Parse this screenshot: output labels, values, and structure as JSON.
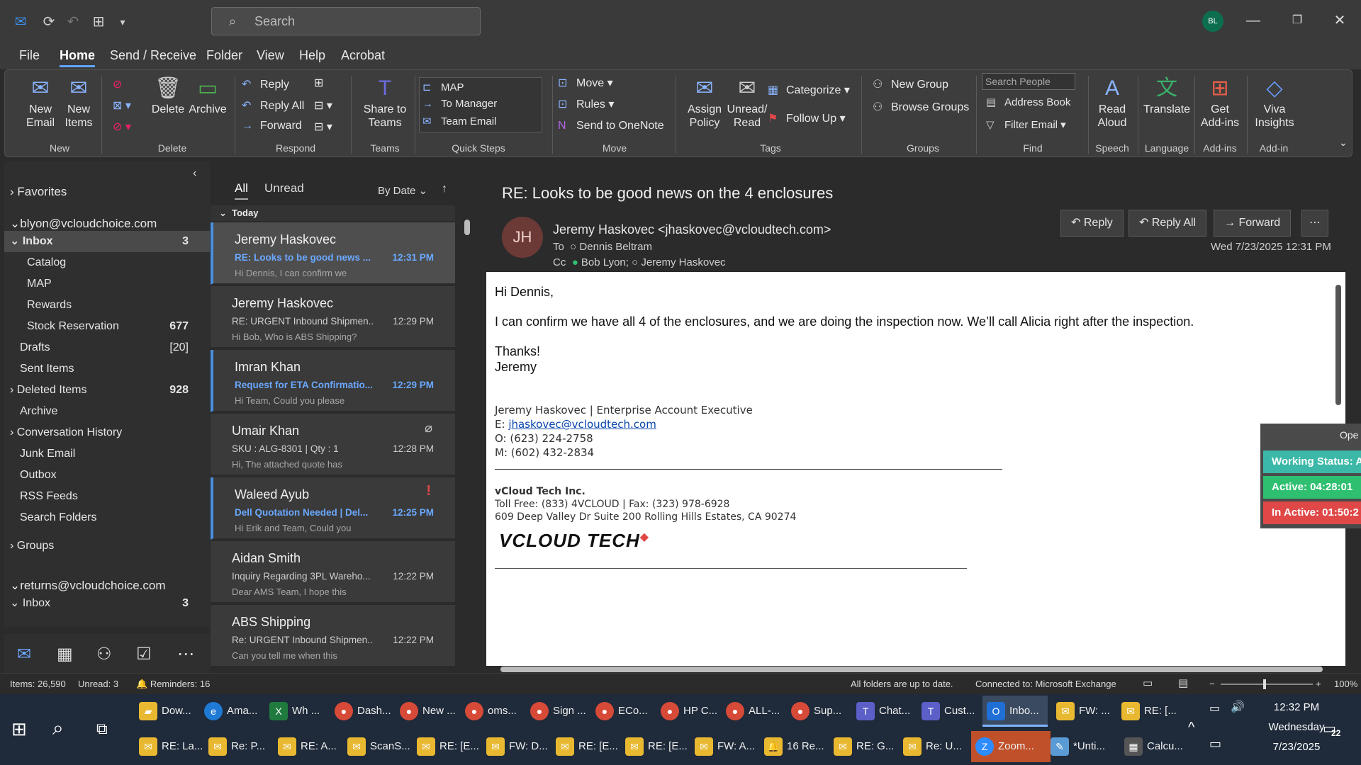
{
  "titlebar": {
    "search_placeholder": "Search",
    "avatar": "BL"
  },
  "menu": [
    "File",
    "Home",
    "Send / Receive",
    "Folder",
    "View",
    "Help",
    "Acrobat"
  ],
  "ribbon": {
    "new_email": "New Email",
    "new_items": "New Items",
    "delete": "Delete",
    "archive": "Archive",
    "reply": "Reply",
    "reply_all": "Reply All",
    "forward": "Forward",
    "share_teams": "Share to Teams",
    "qs1": "MAP",
    "qs2": "To Manager",
    "qs3": "Team Email",
    "move": "Move",
    "rules": "Rules",
    "send_onenote": "Send to OneNote",
    "assign_policy": "Assign Policy",
    "unread_read": "Unread/ Read",
    "categorize": "Categorize",
    "follow_up": "Follow Up",
    "new_group": "New Group",
    "browse_groups": "Browse Groups",
    "search_people": "Search People",
    "address_book": "Address Book",
    "filter_email": "Filter Email",
    "read_aloud": "Read Aloud",
    "translate": "Translate",
    "get_addins": "Get Add-ins",
    "viva": "Viva Insights",
    "groups": [
      "New",
      "Delete",
      "Respond",
      "Teams",
      "Quick Steps",
      "Move",
      "Tags",
      "Groups",
      "Find",
      "Speech",
      "Language",
      "Add-ins",
      "Add-in"
    ]
  },
  "nav": {
    "favorites": "Favorites",
    "account1": "blyon@vcloudchoice.com",
    "folders": [
      {
        "label": "Inbox",
        "count": "3"
      },
      {
        "label": "Catalog",
        "count": ""
      },
      {
        "label": "MAP",
        "count": ""
      },
      {
        "label": "Rewards",
        "count": ""
      },
      {
        "label": "Stock Reservation",
        "count": "677"
      },
      {
        "label": "Drafts",
        "count": "[20]"
      },
      {
        "label": "Sent Items",
        "count": ""
      },
      {
        "label": "Deleted Items",
        "count": "928"
      },
      {
        "label": "Archive",
        "count": ""
      },
      {
        "label": "Conversation History",
        "count": ""
      },
      {
        "label": "Junk Email",
        "count": ""
      },
      {
        "label": "Outbox",
        "count": ""
      },
      {
        "label": "RSS Feeds",
        "count": ""
      },
      {
        "label": "Search Folders",
        "count": ""
      },
      {
        "label": "Groups",
        "count": ""
      }
    ],
    "account2": "returns@vcloudchoice.com",
    "inbox2": "Inbox",
    "inbox2_count": "3"
  },
  "list": {
    "tab_all": "All",
    "tab_unread": "Unread",
    "sort": "By Date",
    "group": "Today",
    "items": [
      {
        "sender": "Jeremy Haskovec",
        "subject": "RE: Looks to be good news ...",
        "time": "12:31 PM",
        "preview": "Hi Dennis,  I can confirm we"
      },
      {
        "sender": "Jeremy Haskovec",
        "subject": "RE: URGENT Inbound Shipmen...",
        "time": "12:29 PM",
        "preview": "Hi Bob,  Who is ABS Shipping?"
      },
      {
        "sender": "Imran Khan",
        "subject": "Request for ETA Confirmatio...",
        "time": "12:29 PM",
        "preview": "Hi Team,  Could you please"
      },
      {
        "sender": "Umair Khan",
        "subject": "SKU : ALG-8301 | Qty : 1",
        "time": "12:28 PM",
        "preview": "Hi,  The attached quote has"
      },
      {
        "sender": "Waleed Ayub",
        "subject": "Dell Quotation Needed | Del...",
        "time": "12:25 PM",
        "preview": "Hi Erik and Team,  Could you"
      },
      {
        "sender": "Aidan Smith",
        "subject": "Inquiry Regarding 3PL Wareho...",
        "time": "12:22 PM",
        "preview": "Dear AMS Team,  I hope this"
      },
      {
        "sender": "ABS Shipping",
        "subject": "Re: URGENT Inbound Shipmen...",
        "time": "12:22 PM",
        "preview": "Can you tell me when this"
      }
    ]
  },
  "reading": {
    "subject": "RE: Looks to be good news on the 4 enclosures",
    "initials": "JH",
    "from": "Jeremy Haskovec <jhaskovec@vcloudtech.com>",
    "to_label": "To",
    "to": "Dennis Beltram",
    "cc_label": "Cc",
    "cc1": "Bob Lyon;",
    "cc2": "Jeremy Haskovec",
    "date": "Wed 7/23/2025 12:31 PM",
    "reply": "Reply",
    "reply_all": "Reply All",
    "forward": "Forward",
    "greeting": "Hi Dennis,",
    "line1": "I can confirm we have all 4 of the enclosures, and we are doing the inspection now.  We’ll call Alicia right after the inspection.",
    "thanks": "Thanks!",
    "name": "Jeremy",
    "sig_title": "Jeremy Haskovec | Enterprise Account Executive",
    "sig_email_label": "E: ",
    "sig_email": "jhaskovec@vcloudtech.com",
    "sig_o": "O: (623) 224-2758",
    "sig_m": "M: (602) 432-2834",
    "company": "vCloud Tech Inc.",
    "tollfree": "Toll Free: (833) 4VCLOUD | Fax: (323) 978-6928",
    "address": "609 Deep Valley Dr Suite 200 Rolling Hills Estates, CA 90274",
    "logo": "VCLOUD TECH"
  },
  "timer": {
    "open": "Ope",
    "working": "Working Status: A",
    "active": "Active: 04:28:01",
    "inactive": "In Active: 01:50:2"
  },
  "status": {
    "items": "Items: 26,590",
    "unread": "Unread: 3",
    "reminders": "Reminders: 16",
    "uptodate": "All folders are up to date.",
    "connected": "Connected to: Microsoft Exchange",
    "zoom": "100%"
  },
  "taskbar": {
    "row1": [
      "Dow...",
      "Ama...",
      "Wh ...",
      "Dash...",
      "New ...",
      "oms...",
      "Sign ...",
      "ECo...",
      "HP C...",
      "ALL-...",
      "Sup...",
      "Chat...",
      "Cust...",
      "Inbo...",
      "FW: ...",
      "RE: [..."
    ],
    "row2": [
      "RE: La...",
      "Re: P...",
      "RE: A...",
      "ScanS...",
      "RE: [E...",
      "FW: D...",
      "RE: [E...",
      "RE: [E...",
      "FW: A...",
      "16 Re...",
      "RE: G...",
      "Re: U...",
      "Zoom...",
      "*Unti...",
      "Calcu..."
    ],
    "time": "12:32 PM",
    "day": "Wednesday",
    "date": "7/23/2025",
    "notif": "22"
  },
  "colors": {
    "accent": "#4a8fe0",
    "active_green": "#2fbf71",
    "inactive_red": "#e04848",
    "status_teal": "#3cb8a8"
  }
}
